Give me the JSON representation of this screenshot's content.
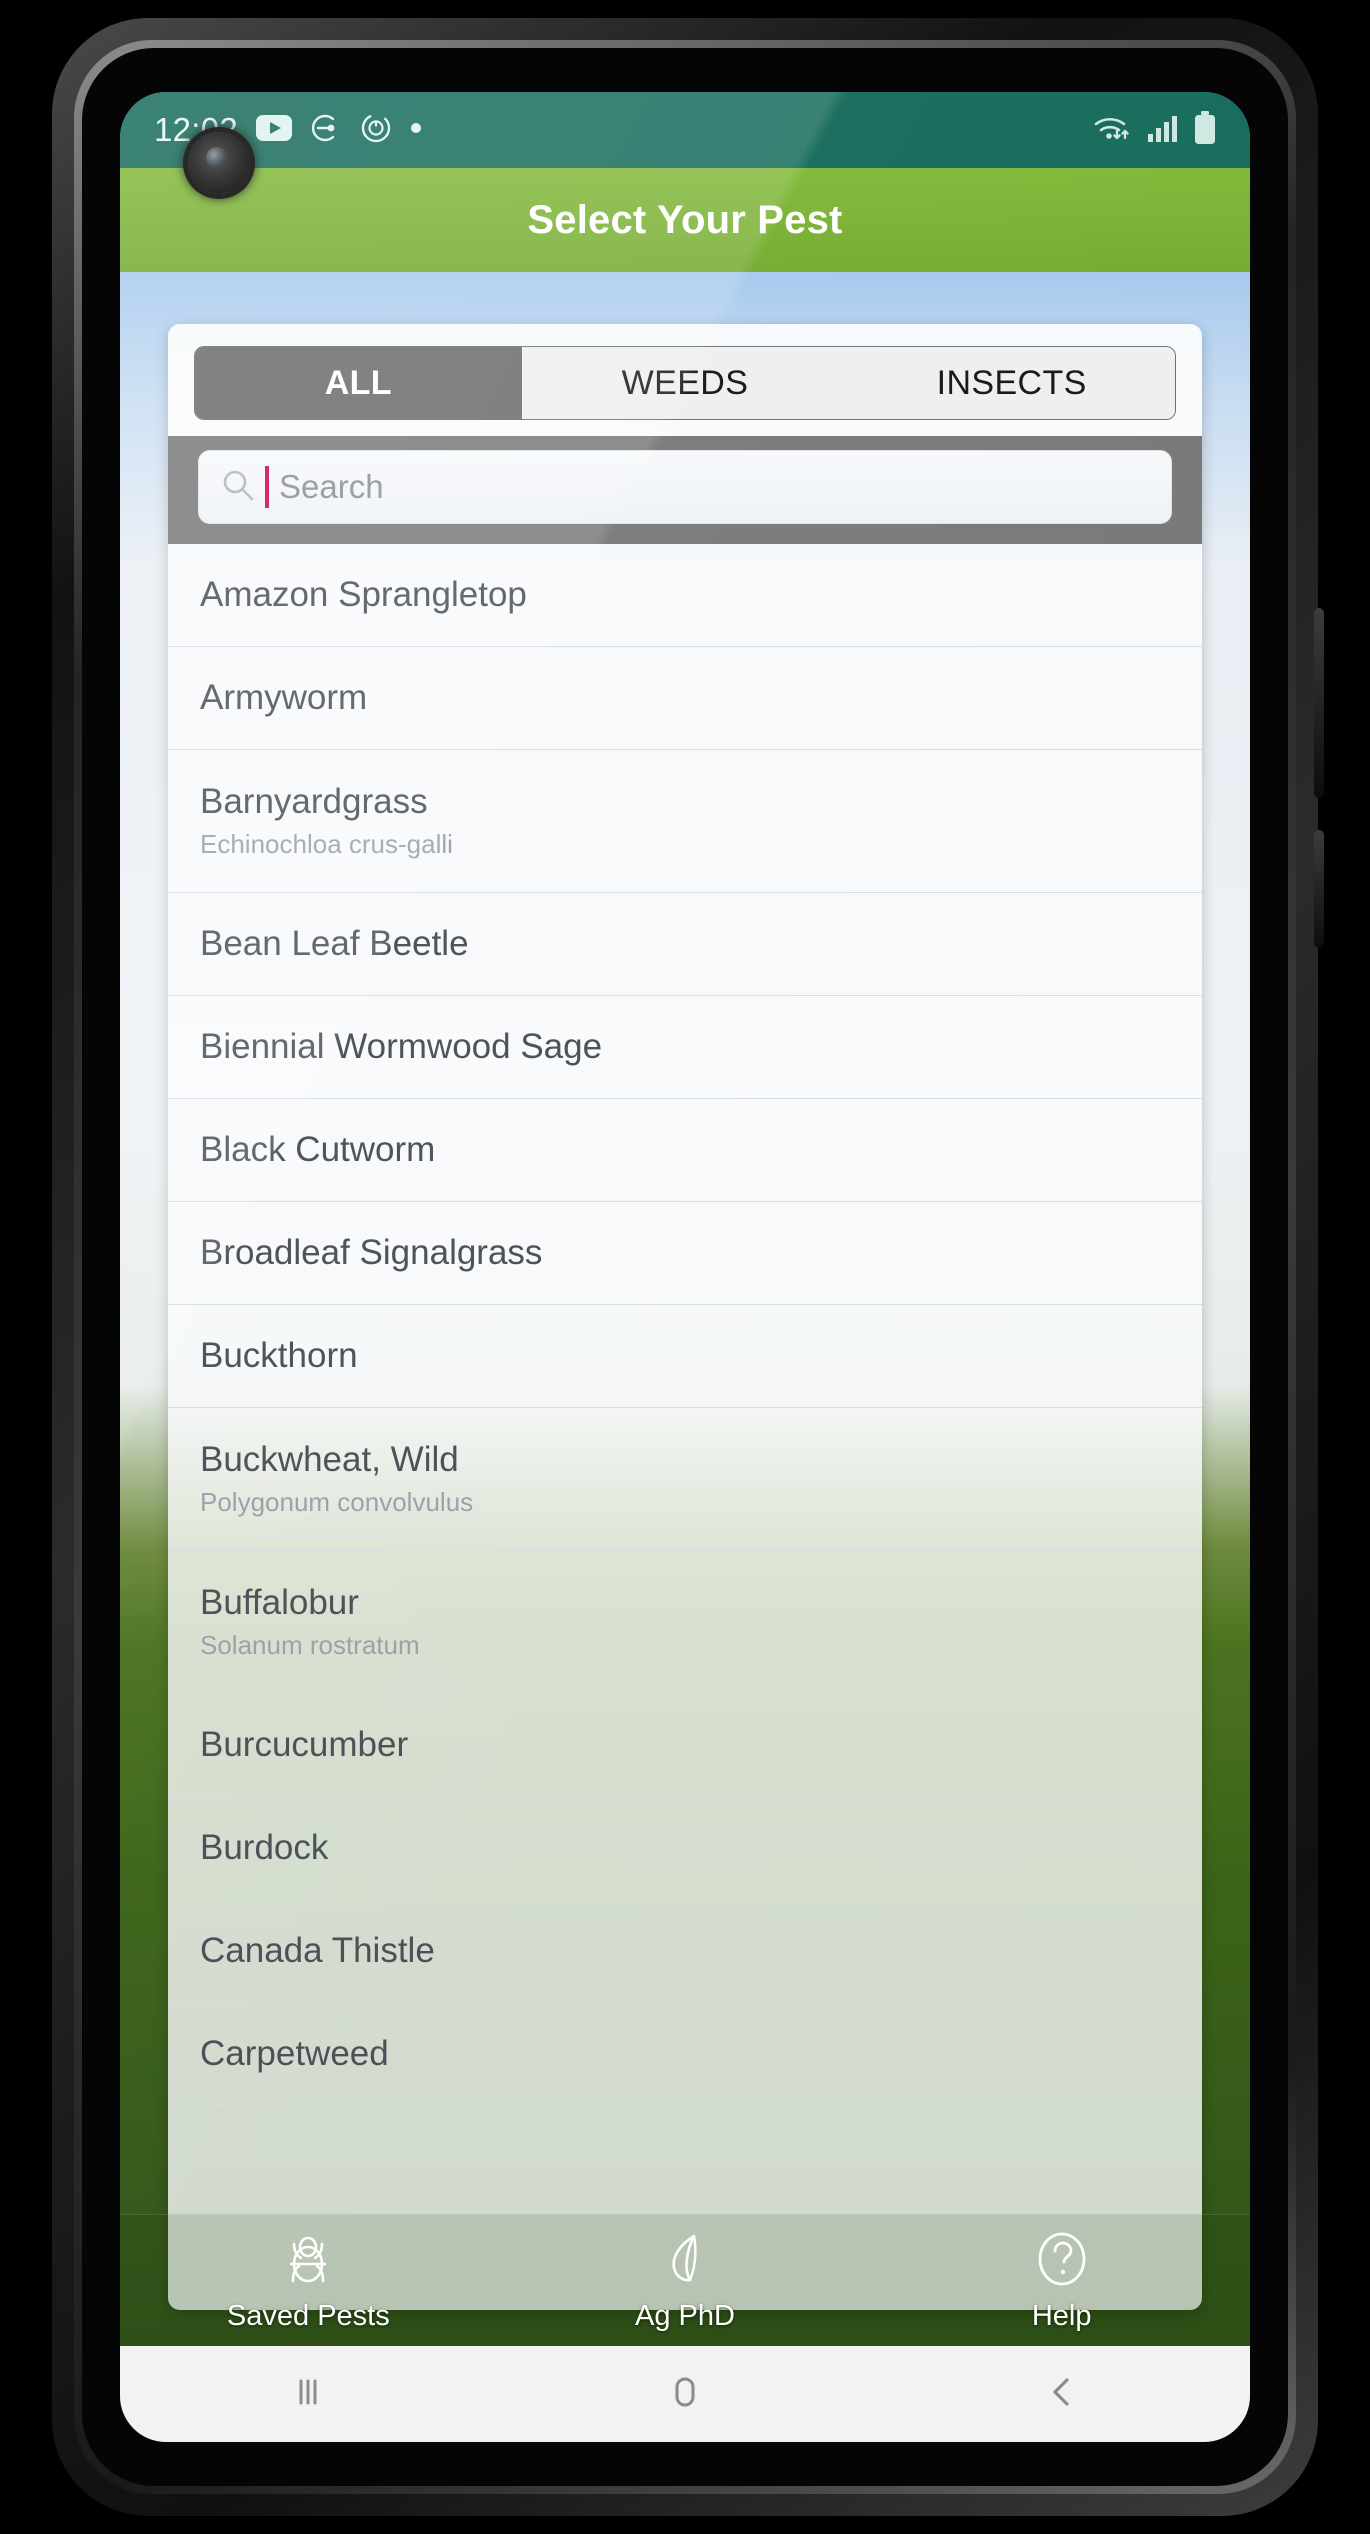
{
  "status_bar": {
    "time": "12:02",
    "left_icons": [
      "youtube-icon",
      "arrow-into-circle-icon",
      "sync-circle-icon",
      "dot-icon"
    ],
    "right_icons": [
      "wifi-icon",
      "cellular-signal-icon",
      "battery-icon"
    ]
  },
  "app_bar": {
    "title": "Select Your Pest"
  },
  "tabs": {
    "items": [
      {
        "label": "ALL",
        "selected": true
      },
      {
        "label": "WEEDS",
        "selected": false
      },
      {
        "label": "INSECTS",
        "selected": false
      }
    ]
  },
  "search": {
    "placeholder": "Search",
    "value": ""
  },
  "pest_list": [
    {
      "name": "Amazon Sprangletop",
      "scientific": ""
    },
    {
      "name": "Armyworm",
      "scientific": ""
    },
    {
      "name": "Barnyardgrass",
      "scientific": "Echinochloa crus-galli"
    },
    {
      "name": "Bean Leaf Beetle",
      "scientific": ""
    },
    {
      "name": "Biennial Wormwood Sage",
      "scientific": ""
    },
    {
      "name": "Black Cutworm",
      "scientific": ""
    },
    {
      "name": "Broadleaf Signalgrass",
      "scientific": ""
    },
    {
      "name": "Buckthorn",
      "scientific": ""
    },
    {
      "name": "Buckwheat, Wild",
      "scientific": "Polygonum convolvulus"
    },
    {
      "name": "Buffalobur",
      "scientific": "Solanum rostratum"
    },
    {
      "name": "Burcucumber",
      "scientific": ""
    },
    {
      "name": "Burdock",
      "scientific": ""
    },
    {
      "name": "Canada Thistle",
      "scientific": ""
    },
    {
      "name": "Carpetweed",
      "scientific": ""
    }
  ],
  "bottom_nav": [
    {
      "label": "Saved Pests",
      "icon": "bug-icon"
    },
    {
      "label": "Ag PhD",
      "icon": "leaf-icon"
    },
    {
      "label": "Help",
      "icon": "question-circle-icon"
    }
  ],
  "android_nav": [
    {
      "icon": "recents-icon"
    },
    {
      "icon": "home-icon"
    },
    {
      "icon": "back-icon"
    }
  ],
  "colors": {
    "status_bar": "#166B5B",
    "app_bar_green": "#7CB334",
    "tab_selected": "#6B6B6B",
    "search_strip": "#797979",
    "caret": "#D3004E",
    "grass": "#3C6418"
  }
}
